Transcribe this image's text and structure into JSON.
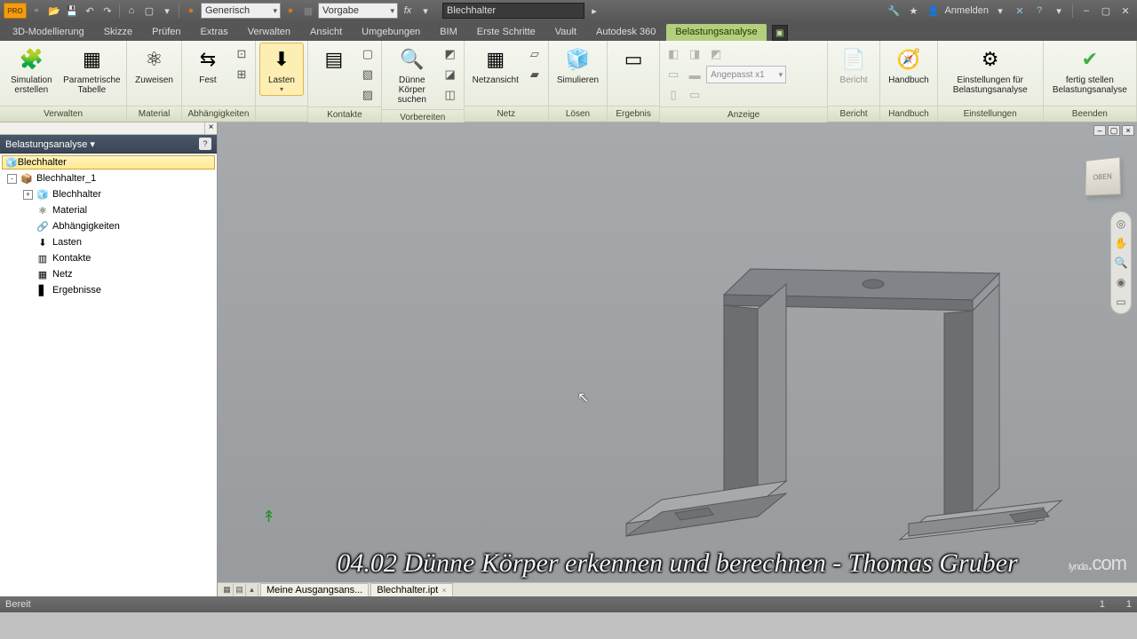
{
  "qat": {
    "logo_text": "PRO",
    "combo1": "Generisch",
    "combo2": "Vorgabe",
    "search_value": "Blechhalter",
    "signin": "Anmelden"
  },
  "tabs": [
    "3D-Modellierung",
    "Skizze",
    "Prüfen",
    "Extras",
    "Verwalten",
    "Ansicht",
    "Umgebungen",
    "BIM",
    "Erste Schritte",
    "Vault",
    "Autodesk 360",
    "Belastungsanalyse"
  ],
  "active_tab": 11,
  "ribbon": {
    "panels": [
      {
        "title": "Verwalten",
        "items": [
          {
            "label": "Simulation erstellen",
            "icon": "🧩"
          },
          {
            "label": "Parametrische Tabelle",
            "icon": "▦"
          }
        ]
      },
      {
        "title": "Material",
        "items": [
          {
            "label": "Zuweisen",
            "icon": "⚛"
          }
        ]
      },
      {
        "title": "Abhängigkeiten",
        "items": [
          {
            "label": "Fest",
            "icon": "⇆"
          }
        ],
        "small": [
          "⊡",
          "⊞"
        ]
      },
      {
        "title": "",
        "items": [
          {
            "label": "Lasten",
            "icon": "⬇",
            "active": true,
            "dropdown": true
          }
        ]
      },
      {
        "title": "Kontakte",
        "items": [
          {
            "label": "",
            "icon": "▤"
          }
        ],
        "small": [
          "▢",
          "▧",
          "▨"
        ]
      },
      {
        "title": "Vorbereiten",
        "items": [
          {
            "label": "Dünne Körper suchen",
            "icon": "🔍"
          }
        ],
        "small": [
          "◩",
          "◪",
          "◫"
        ]
      },
      {
        "title": "Netz",
        "items": [
          {
            "label": "Netzansicht",
            "icon": "▦"
          }
        ],
        "small": [
          "▱",
          "▰"
        ]
      },
      {
        "title": "Lösen",
        "items": [
          {
            "label": "Simulieren",
            "icon": "🧊"
          }
        ]
      },
      {
        "title": "Ergebnis",
        "items": [
          {
            "label": "",
            "icon": "▭"
          }
        ]
      },
      {
        "title": "Anzeige",
        "scale_label": "Angepasst x1"
      },
      {
        "title": "Bericht",
        "items": [
          {
            "label": "Bericht",
            "icon": "📄",
            "disabled": true
          }
        ]
      },
      {
        "title": "Handbuch",
        "items": [
          {
            "label": "Handbuch",
            "icon": "🧭"
          }
        ]
      },
      {
        "title": "Einstellungen",
        "items": [
          {
            "label": "Einstellungen für Belastungsanalyse",
            "icon": "⚙"
          }
        ]
      },
      {
        "title": "Beenden",
        "items": [
          {
            "label": "fertig stellen Belastungsanalyse",
            "icon": "✔",
            "green": true
          }
        ]
      }
    ]
  },
  "browser": {
    "title": "Belastungsanalyse",
    "root": "Blechhalter",
    "nodes": [
      {
        "depth": 0,
        "exp": "-",
        "icon": "📦",
        "label": "Blechhalter_1"
      },
      {
        "depth": 1,
        "exp": "+",
        "icon": "🧊",
        "label": "Blechhalter"
      },
      {
        "depth": 1,
        "exp": "",
        "icon": "⚛",
        "label": "Material"
      },
      {
        "depth": 1,
        "exp": "",
        "icon": "🔗",
        "label": "Abhängigkeiten"
      },
      {
        "depth": 1,
        "exp": "",
        "icon": "⬇",
        "label": "Lasten"
      },
      {
        "depth": 1,
        "exp": "",
        "icon": "▥",
        "label": "Kontakte"
      },
      {
        "depth": 1,
        "exp": "",
        "icon": "▦",
        "label": "Netz"
      },
      {
        "depth": 1,
        "exp": "",
        "icon": "▋",
        "label": "Ergebnisse"
      }
    ]
  },
  "viewcube": "OBEN",
  "doc_tabs": [
    {
      "label": "Meine Ausgangsans...",
      "closable": false
    },
    {
      "label": "Blechhalter.ipt",
      "closable": true
    }
  ],
  "caption": "04.02 Dünne Körper erkennen und berechnen - Thomas Gruber",
  "watermark": "lynda",
  "watermark_ext": ".com",
  "status": {
    "left": "Bereit",
    "r1": "1",
    "r2": "1"
  }
}
